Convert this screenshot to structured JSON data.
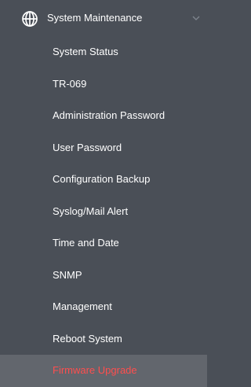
{
  "menu": {
    "section": {
      "label": "System Maintenance",
      "icon": "globe-icon",
      "expand_icon": "chevron-down-icon"
    },
    "items": [
      {
        "label": "System Status"
      },
      {
        "label": "TR-069"
      },
      {
        "label": "Administration Password"
      },
      {
        "label": "User Password"
      },
      {
        "label": "Configuration Backup"
      },
      {
        "label": "Syslog/Mail Alert"
      },
      {
        "label": "Time and Date"
      },
      {
        "label": "SNMP"
      },
      {
        "label": "Management"
      },
      {
        "label": "Reboot System"
      },
      {
        "label": "Firmware Upgrade",
        "active": true
      }
    ]
  },
  "colors": {
    "background": "#4a4f57",
    "active_background": "#62666d",
    "active_text": "#ff4e4e",
    "text": "#ffffff"
  }
}
